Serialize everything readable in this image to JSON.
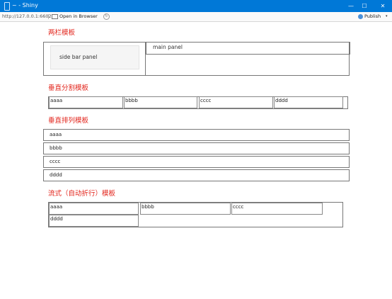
{
  "window": {
    "title": "~ - Shiny",
    "controls": {
      "minimize": "—",
      "maximize": "☐",
      "close": "✕"
    }
  },
  "toolbar": {
    "url": "http://127.0.0.1:6602",
    "open_in_browser": "Open in Browser",
    "publish": "Publish",
    "refresh_glyph": "↻",
    "caret": "▾"
  },
  "sections": {
    "two_column": {
      "heading": "两栏模板",
      "sidebar_label": "side bar panel",
      "main_label": "main panel"
    },
    "vertical_split": {
      "heading": "垂直分割模板",
      "cells": [
        "aaaa",
        "bbbb",
        "cccc",
        "dddd"
      ]
    },
    "vertical_stack": {
      "heading": "垂直排列模板",
      "rows": [
        "aaaa",
        "bbbb",
        "cccc",
        "dddd"
      ]
    },
    "flow": {
      "heading": "流式（自动折行）模板",
      "cells": [
        "aaaa",
        "bbbb",
        "cccc",
        "dddd"
      ]
    }
  },
  "colors": {
    "titlebar": "#0078d7",
    "heading": "#e2231a",
    "border": "#777777",
    "sidebar_bg": "#f5f5f5"
  }
}
